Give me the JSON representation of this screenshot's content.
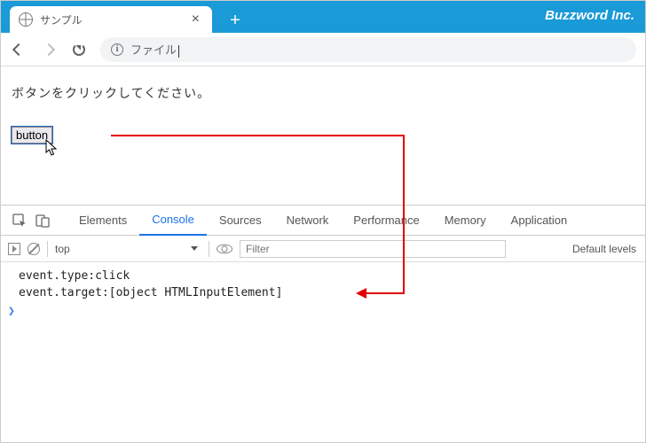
{
  "topbar": {
    "tab_title": "サンプル",
    "brand": "Buzzword Inc."
  },
  "urlbar": {
    "address_label": "ファイル"
  },
  "page": {
    "instruction": "ボタンをクリックしてください。",
    "button_label": "button"
  },
  "devtools": {
    "tabs": {
      "elements": "Elements",
      "console": "Console",
      "sources": "Sources",
      "network": "Network",
      "performance": "Performance",
      "memory": "Memory",
      "application": "Application"
    },
    "toolbar": {
      "context": "top",
      "filter_placeholder": "Filter",
      "levels": "Default levels"
    },
    "console_lines": {
      "l0": "event.type:click",
      "l1": "event.target:[object HTMLInputElement]"
    },
    "prompt": "❯"
  }
}
